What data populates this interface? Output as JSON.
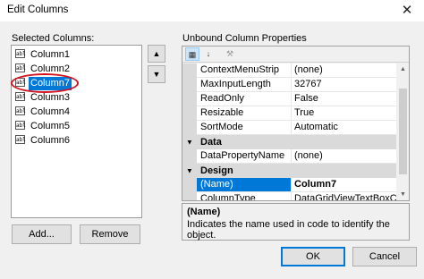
{
  "window": {
    "title": "Edit Columns",
    "close_glyph": "✕"
  },
  "left": {
    "label": "Selected Columns:",
    "columns": [
      "Column1",
      "Column2",
      "Column7",
      "Column3",
      "Column4",
      "Column5",
      "Column6"
    ],
    "selected_index": 2,
    "icon_text": "abl",
    "up_glyph": "▲",
    "down_glyph": "▼",
    "add_label": "Add...",
    "remove_label": "Remove"
  },
  "right": {
    "label": "Unbound Column Properties",
    "toolbar": {
      "categorized_glyph": "▦",
      "alpha_glyph": "↓",
      "pages_glyph": "⚒"
    },
    "rows": [
      {
        "name": "ContextMenuStrip",
        "value": "(none)"
      },
      {
        "name": "MaxInputLength",
        "value": "32767"
      },
      {
        "name": "ReadOnly",
        "value": "False"
      },
      {
        "name": "Resizable",
        "value": "True"
      },
      {
        "name": "SortMode",
        "value": "Automatic"
      },
      {
        "category": "Data"
      },
      {
        "name": "DataPropertyName",
        "value": "(none)"
      },
      {
        "category": "Design"
      },
      {
        "name": "(Name)",
        "value": "Column7",
        "selected": true
      },
      {
        "name": "ColumnType",
        "value": "DataGridViewTextBoxColum"
      }
    ],
    "help_title": "(Name)",
    "help_text": "Indicates the name used in code to identify the object."
  },
  "footer": {
    "ok_label": "OK",
    "cancel_label": "Cancel"
  }
}
